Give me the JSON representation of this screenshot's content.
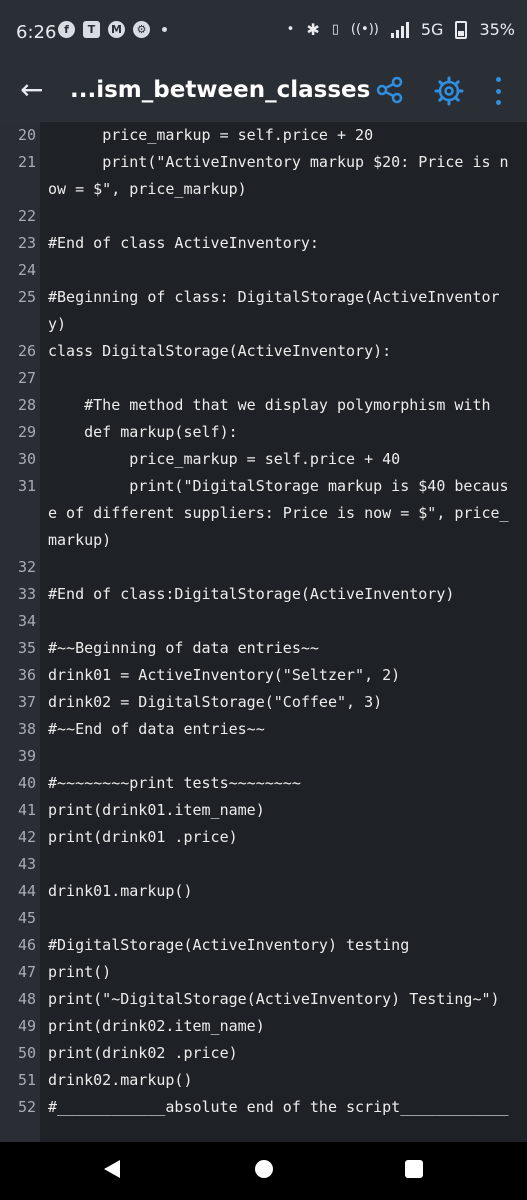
{
  "status_bar": {
    "time": "6:26",
    "network": "5G",
    "battery": "35%"
  },
  "app_bar": {
    "title": "...ism_between_classes",
    "accent_color": "#2f8fe0"
  },
  "code_lines": [
    {
      "n": "20",
      "text": "      price_markup = self.price + 20"
    },
    {
      "n": "21",
      "text": "      print(\"ActiveInventory markup $20: Price is now = $\", price_markup)"
    },
    {
      "n": "22",
      "text": ""
    },
    {
      "n": "23",
      "text": "#End of class ActiveInventory:"
    },
    {
      "n": "24",
      "text": ""
    },
    {
      "n": "25",
      "text": "#Beginning of class: DigitalStorage(ActiveInventory)"
    },
    {
      "n": "26",
      "text": "class DigitalStorage(ActiveInventory):"
    },
    {
      "n": "27",
      "text": ""
    },
    {
      "n": "28",
      "text": "    #The method that we display polymorphism with"
    },
    {
      "n": "29",
      "text": "    def markup(self):"
    },
    {
      "n": "30",
      "text": "         price_markup = self.price + 40"
    },
    {
      "n": "31",
      "text": "         print(\"DigitalStorage markup is $40 because of different suppliers: Price is now = $\", price_markup)"
    },
    {
      "n": "32",
      "text": ""
    },
    {
      "n": "33",
      "text": "#End of class:DigitalStorage(ActiveInventory)"
    },
    {
      "n": "34",
      "text": ""
    },
    {
      "n": "35",
      "text": "#~~Beginning of data entries~~"
    },
    {
      "n": "36",
      "text": "drink01 = ActiveInventory(\"Seltzer\", 2)"
    },
    {
      "n": "37",
      "text": "drink02 = DigitalStorage(\"Coffee\", 3)"
    },
    {
      "n": "38",
      "text": "#~~End of data entries~~"
    },
    {
      "n": "39",
      "text": ""
    },
    {
      "n": "40",
      "text": "#~~~~~~~~print tests~~~~~~~~"
    },
    {
      "n": "41",
      "text": "print(drink01.item_name)"
    },
    {
      "n": "42",
      "text": "print(drink01 .price)"
    },
    {
      "n": "43",
      "text": ""
    },
    {
      "n": "44",
      "text": "drink01.markup()"
    },
    {
      "n": "45",
      "text": ""
    },
    {
      "n": "46",
      "text": "#DigitalStorage(ActiveInventory) testing"
    },
    {
      "n": "47",
      "text": "print()"
    },
    {
      "n": "48",
      "text": "print(\"~DigitalStorage(ActiveInventory) Testing~\")"
    },
    {
      "n": "49",
      "text": "print(drink02.item_name)"
    },
    {
      "n": "50",
      "text": "print(drink02 .price)"
    },
    {
      "n": "51",
      "text": "drink02.markup()"
    },
    {
      "n": "52",
      "text": "#____________absolute end of the script________________"
    }
  ]
}
